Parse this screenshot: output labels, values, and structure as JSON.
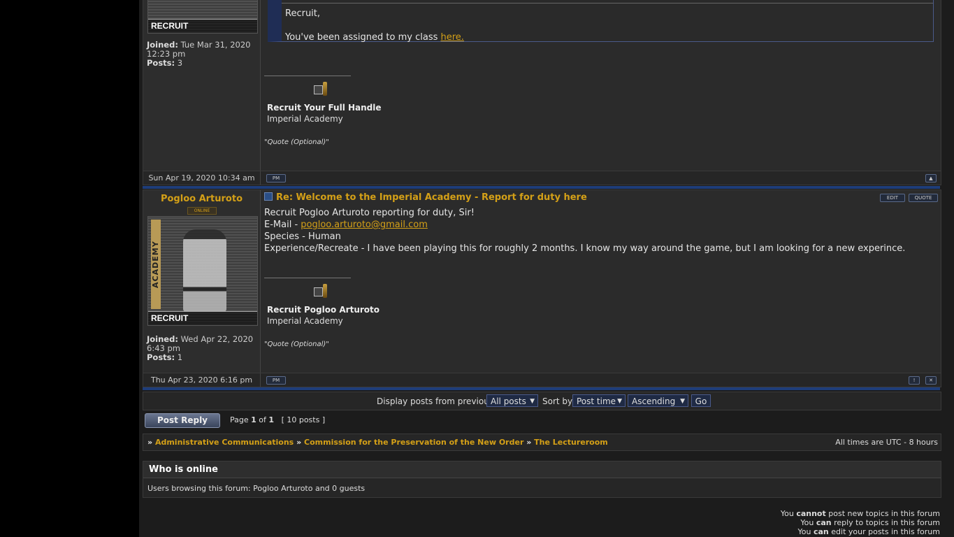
{
  "post1": {
    "rank_label": "RECRUIT",
    "joined_label": "Joined:",
    "joined_value": "Tue Mar 31, 2020 12:23 pm",
    "posts_label": "Posts:",
    "posts_value": "3",
    "quote_line1": "Recruit,",
    "quote_line2_prefix": "You've been assigned to my class ",
    "quote_link": "here.",
    "sig_name": "Recruit Your Full Handle",
    "sig_org": "Imperial Academy",
    "sig_quote": "\"Quote (Optional)\"",
    "date": "Sun Apr 19, 2020 10:34 am",
    "pm_label": "PM"
  },
  "post2": {
    "author": "Pogloo Arturoto",
    "online_label": "ONLINE",
    "avatar_banner": "ACADEMY",
    "rank_label": "RECRUIT",
    "joined_label": "Joined:",
    "joined_value": "Wed Apr 22, 2020 6:43 pm",
    "posts_label": "Posts:",
    "posts_value": "1",
    "title": "Re: Welcome to the Imperial Academy - Report for duty here",
    "edit_label": "EDIT",
    "quote_label": "QUOTE",
    "line1": "Recruit Pogloo Arturoto reporting for duty, Sir!",
    "email_prefix": "E-Mail - ",
    "email": "pogloo.arturoto@gmail.com",
    "line3": "Species - Human",
    "line4": "Experience/Recreate - I have been playing this for roughly 2 months. I know my way around the game, but I am looking for a new experince.",
    "sig_name": "Recruit Pogloo Arturoto",
    "sig_org": "Imperial Academy",
    "sig_quote": "\"Quote (Optional)\"",
    "date": "Thu Apr 23, 2020 6:16 pm",
    "pm_label": "PM"
  },
  "controls": {
    "display_label": "Display posts from previous:",
    "display_value": "All posts",
    "sort_label": "Sort by",
    "sort_value": "Post time",
    "order_value": "Ascending",
    "go_label": "Go"
  },
  "pagination": {
    "reply_label": "Post Reply",
    "page_prefix": "Page ",
    "page_current": "1",
    "page_of": " of ",
    "page_total": "1",
    "posts_count": "[ 10 posts ]"
  },
  "breadcrumb": {
    "sep": "»",
    "items": [
      "Administrative Communications",
      "Commission for the Preservation of the New Order",
      "The Lectureroom"
    ],
    "timezone": "All times are UTC - 8 hours"
  },
  "who_online": {
    "title": "Who is online",
    "text": "Users browsing this forum: Pogloo Arturoto and 0 guests"
  },
  "permissions": {
    "you": "You",
    "l1_bold": "cannot",
    "l1_rest": " post new topics in this forum",
    "l2_bold": "can",
    "l2_rest": " reply to topics in this forum",
    "l3_bold": "can",
    "l3_rest": " edit your posts in this forum"
  }
}
